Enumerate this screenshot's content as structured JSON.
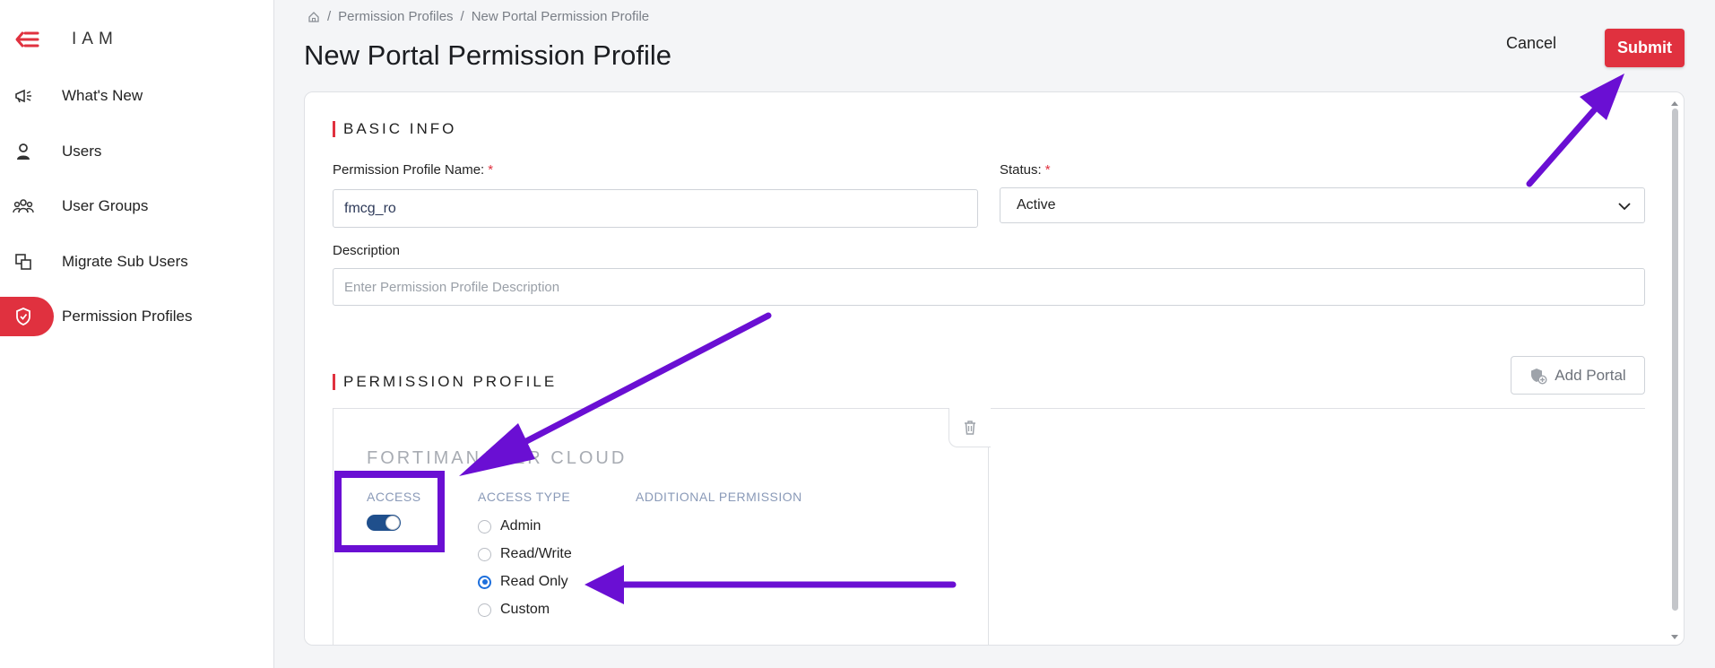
{
  "app": {
    "title": "IAM"
  },
  "sidebar": {
    "items": [
      {
        "label": "What's New",
        "icon": "megaphone-icon",
        "active": false
      },
      {
        "label": "Users",
        "icon": "user-icon",
        "active": false
      },
      {
        "label": "User Groups",
        "icon": "user-group-icon",
        "active": false
      },
      {
        "label": "Migrate Sub Users",
        "icon": "migrate-icon",
        "active": false
      },
      {
        "label": "Permission Profiles",
        "icon": "shield-icon",
        "active": true
      }
    ]
  },
  "breadcrumb": {
    "items": [
      "Permission Profiles",
      "New Portal Permission Profile"
    ],
    "separator": "/"
  },
  "header": {
    "title": "New Portal Permission Profile",
    "cancel_label": "Cancel",
    "submit_label": "Submit"
  },
  "basic_info": {
    "heading": "BASIC INFO",
    "name_label": "Permission Profile Name:",
    "name_value": "fmcg_ro",
    "required_mark": "*",
    "status_label": "Status:",
    "status_value": "Active",
    "description_label": "Description",
    "description_placeholder": "Enter Permission Profile Description"
  },
  "permission_profile": {
    "heading": "PERMISSION PROFILE",
    "add_portal_label": "Add Portal",
    "portal": {
      "name": "FORTIMANAGER CLOUD",
      "access_label": "ACCESS",
      "access_enabled": true,
      "access_type_label": "ACCESS TYPE",
      "additional_permission_label": "ADDITIONAL PERMISSION",
      "access_types": [
        {
          "label": "Admin",
          "checked": false
        },
        {
          "label": "Read/Write",
          "checked": false
        },
        {
          "label": "Read Only",
          "checked": true
        },
        {
          "label": "Custom",
          "checked": false
        }
      ]
    }
  },
  "colors": {
    "accent": "#e0313f",
    "toggle_on": "#1f4f8c",
    "radio_selected": "#1d6fdc",
    "annotation": "#6a0fd3"
  }
}
